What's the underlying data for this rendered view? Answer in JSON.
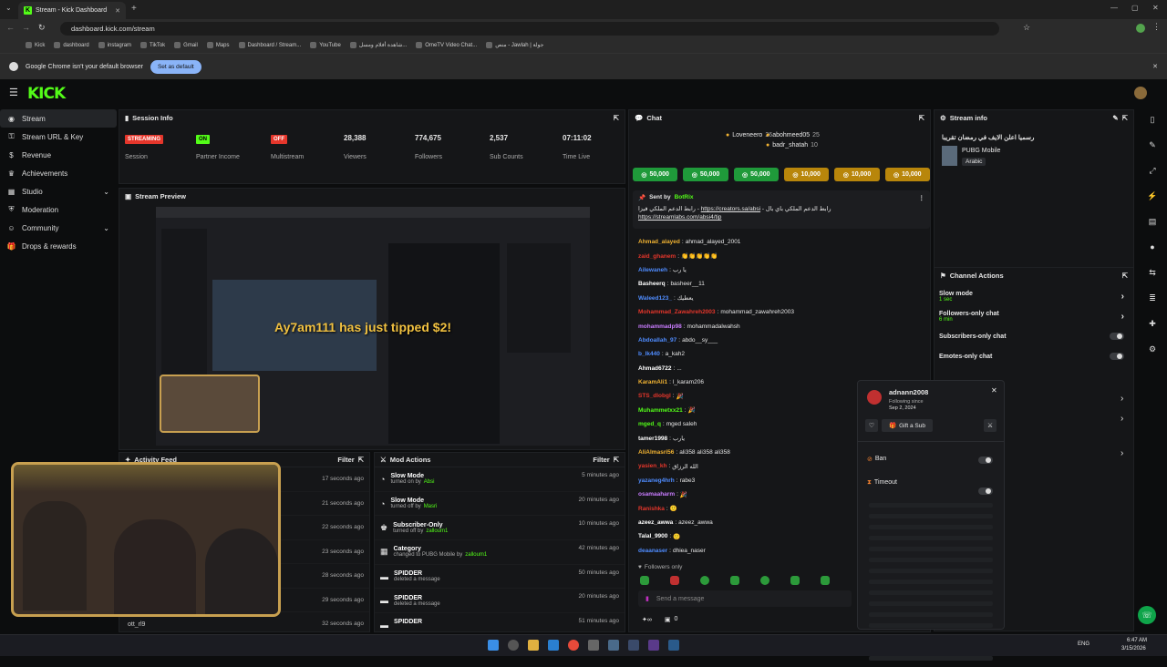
{
  "browser": {
    "tab_title": "Stream - Kick Dashboard",
    "url": "dashboard.kick.com/stream",
    "bookmarks": [
      "Kick",
      "dashboard",
      "instagram",
      "TikTok",
      "Gmail",
      "Maps",
      "Dashboard / Stream...",
      "YouTube",
      "شاهدة أفلام ومسل...",
      "OmeTV Video Chat...",
      "منص - Jawlah | جولة"
    ],
    "infobar_text": "Google Chrome isn't your default browser",
    "infobar_button": "Set as default"
  },
  "kick": {
    "logo": "KICK",
    "nav": [
      {
        "label": "Stream",
        "icon": "broadcast-icon"
      },
      {
        "label": "Stream URL & Key",
        "icon": "key-icon"
      },
      {
        "label": "Revenue",
        "icon": "revenue-icon"
      },
      {
        "label": "Achievements",
        "icon": "trophy-icon"
      },
      {
        "label": "Studio",
        "icon": "studio-icon"
      },
      {
        "label": "Moderation",
        "icon": "shield-icon"
      },
      {
        "label": "Community",
        "icon": "community-icon"
      },
      {
        "label": "Drops & rewards",
        "icon": "gift-icon"
      }
    ],
    "session": {
      "title": "Session Info",
      "stats": [
        {
          "value": "STREAMING",
          "label": "Session",
          "badge": true,
          "color": "#e5362b"
        },
        {
          "value": "ON",
          "label": "Partner Income",
          "badge": true,
          "color": "#53fc18"
        },
        {
          "value": "OFF",
          "label": "Multistream",
          "badge": true,
          "color": "#e5362b"
        },
        {
          "value": "28,388",
          "label": "Viewers"
        },
        {
          "value": "774,675",
          "label": "Followers"
        },
        {
          "value": "2,537",
          "label": "Sub Counts"
        },
        {
          "value": "07:11:02",
          "label": "Time Live"
        }
      ]
    },
    "preview": {
      "title": "Stream Preview",
      "alert": "Ay7am111 has just tipped $2!"
    },
    "activity": {
      "title": "Activity Feed",
      "filter": "Filter",
      "username": "ott_rl9",
      "times": [
        "17 seconds ago",
        "21 seconds ago",
        "22 seconds ago",
        "23 seconds ago",
        "28 seconds ago",
        "29 seconds ago",
        "32 seconds ago"
      ]
    },
    "mod": {
      "title": "Mod Actions",
      "filter": "Filter",
      "rows": [
        {
          "title": "Slow Mode",
          "sub": "turned on by",
          "user": "Absi",
          "time": "5 minutes ago"
        },
        {
          "title": "Slow Mode",
          "sub": "turned off by",
          "user": "Masri",
          "time": "20 minutes ago"
        },
        {
          "title": "Subscriber-Only",
          "sub": "turned off by",
          "user": "zalloum1",
          "time": "10 minutes ago"
        },
        {
          "title": "Category",
          "sub": "changed to PUBG Mobile by",
          "user": "zalloum1",
          "time": "42 minutes ago"
        },
        {
          "title": "SPIDDER",
          "sub": "deleted a message",
          "user": "",
          "time": "50 minutes ago"
        },
        {
          "title": "SPIDDER",
          "sub": "deleted a message",
          "user": "",
          "time": "20 minutes ago"
        },
        {
          "title": "SPIDDER",
          "sub": "",
          "user": "",
          "time": "51 minutes ago"
        }
      ]
    },
    "chat": {
      "title": "Chat",
      "leaderboard": [
        {
          "name": "Loveneero",
          "value": "26"
        },
        {
          "name": "abohmeed05",
          "value": "25"
        },
        {
          "name": "badr_shatah",
          "value": "10"
        }
      ],
      "gifts": [
        {
          "value": "50,000",
          "color": "#1f9a3a"
        },
        {
          "value": "50,000",
          "color": "#1f9a3a"
        },
        {
          "value": "50,000",
          "color": "#1f9a3a"
        },
        {
          "value": "10,000",
          "color": "#b8860b"
        },
        {
          "value": "10,000",
          "color": "#b8860b"
        },
        {
          "value": "10,000",
          "color": "#b8860b"
        }
      ],
      "pinned": {
        "sent_by": "Sent by",
        "bot": "BotRix",
        "text": "رابط الدعم الملكي باي بال - ",
        "link1": "https://creators.sa/absi",
        "text2": " - رابط الدعم الملكي فيزا ",
        "link2": "https://streamlabs.com/absi4/tip"
      },
      "messages": [
        {
          "user": "Ahmad_alayed",
          "color": "#f0b232",
          "text": "ahmad_alayed_2001"
        },
        {
          "user": "zaid_ghanem",
          "color": "#e5362b",
          "text": "👏👏👏👏👏"
        },
        {
          "user": "Ailewaneh",
          "color": "#4f8cff",
          "text": "يا رب"
        },
        {
          "user": "Basheerq",
          "color": "#fff",
          "text": "basheer__11"
        },
        {
          "user": "Waleed123_",
          "color": "#4f8cff",
          "text": "يعطيك"
        },
        {
          "user": "Mohammad_Zawahreh2003",
          "color": "#e5362b",
          "text": "mohammad_zawahreh2003"
        },
        {
          "user": "mohammadp98",
          "color": "#c97cff",
          "text": "mohammadalwahsh"
        },
        {
          "user": "Abdoallah_97",
          "color": "#4f8cff",
          "text": "abdo__sy___"
        },
        {
          "user": "b_lk440",
          "color": "#4f8cff",
          "text": "a_kah2"
        },
        {
          "user": "Ahmad6722",
          "color": "#fff",
          "text": "..."
        },
        {
          "user": "KaramAli1",
          "color": "#f0b232",
          "text": "l_karam206"
        },
        {
          "user": "STS_dlobgl",
          "color": "#e5362b",
          "text": "🎉"
        },
        {
          "user": "Muhammetxx21",
          "color": "#53fc18",
          "text": "🎉"
        },
        {
          "user": "mged_q",
          "color": "#53fc18",
          "text": "mged saleh"
        },
        {
          "user": "tamer1998",
          "color": "#fff",
          "text": "يارب"
        },
        {
          "user": "AliAlmasri56",
          "color": "#f0b232",
          "text": "ali358 ali358 ali358"
        },
        {
          "user": "yasien_kh",
          "color": "#e5362b",
          "text": "الله الرزاق"
        },
        {
          "user": "yazaneg4hrh",
          "color": "#4f8cff",
          "text": "rabe3"
        },
        {
          "user": "osamaaharm",
          "color": "#c97cff",
          "text": "🎉"
        },
        {
          "user": "Ranishka",
          "color": "#e5362b",
          "text": "🙂"
        },
        {
          "user": "azeez_awwa",
          "color": "#fff",
          "text": "azeez_awwa"
        },
        {
          "user": "Talal_9900",
          "color": "#fff",
          "text": "🙂"
        },
        {
          "user": "deaanaser",
          "color": "#4f8cff",
          "text": "dhiea_naser"
        }
      ],
      "followers_only": "Followers only",
      "send_placeholder": "Send a message",
      "count": "0"
    },
    "stream_info": {
      "title": "Stream info",
      "stream_title": "رسميا اعلن الايف في رمضان تقريبا",
      "category": "PUBG Mobile",
      "language": "Arabic"
    },
    "channel_actions": {
      "title": "Channel Actions",
      "rows": [
        {
          "label": "Slow mode",
          "sub": "1 sec",
          "type": "arrow"
        },
        {
          "label": "Followers-only chat",
          "sub": "6 min",
          "type": "arrow"
        },
        {
          "label": "Subscribers-only chat",
          "sub": "",
          "type": "toggle"
        },
        {
          "label": "Emotes-only chat",
          "sub": "",
          "type": "toggle"
        }
      ]
    },
    "user_card": {
      "username": "adnann2008",
      "following_since_label": "Following since",
      "following_since": "Sep 2, 2024",
      "gift_sub": "Gift a Sub",
      "ban": "Ban",
      "timeout": "Timeout"
    }
  },
  "taskbar": {
    "lang": "ENG",
    "time": "6:47 AM",
    "date": "3/15/2026"
  }
}
